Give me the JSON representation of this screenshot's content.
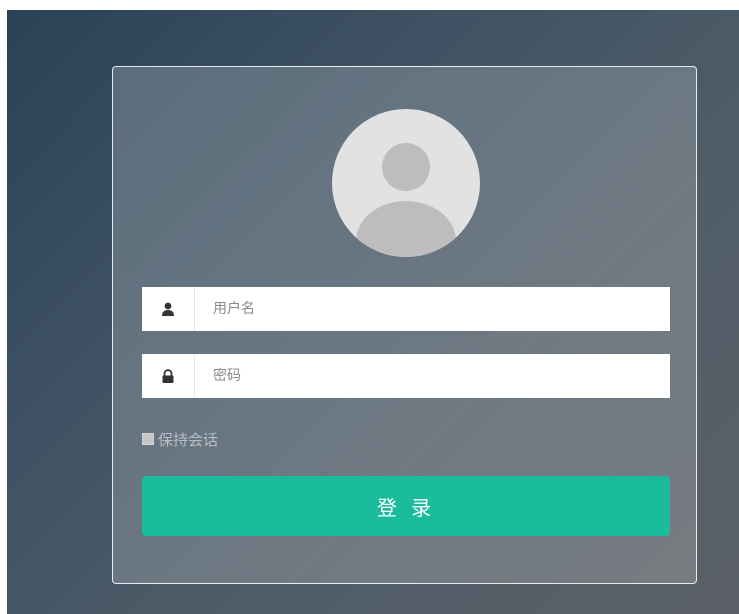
{
  "login": {
    "username_placeholder": "用户名",
    "password_placeholder": "密码",
    "remember_label": "保持会话",
    "submit_label": "登 录"
  },
  "icons": {
    "username": "user-icon",
    "password": "lock-icon",
    "avatar": "default-avatar"
  },
  "colors": {
    "accent": "#1abc9c"
  }
}
